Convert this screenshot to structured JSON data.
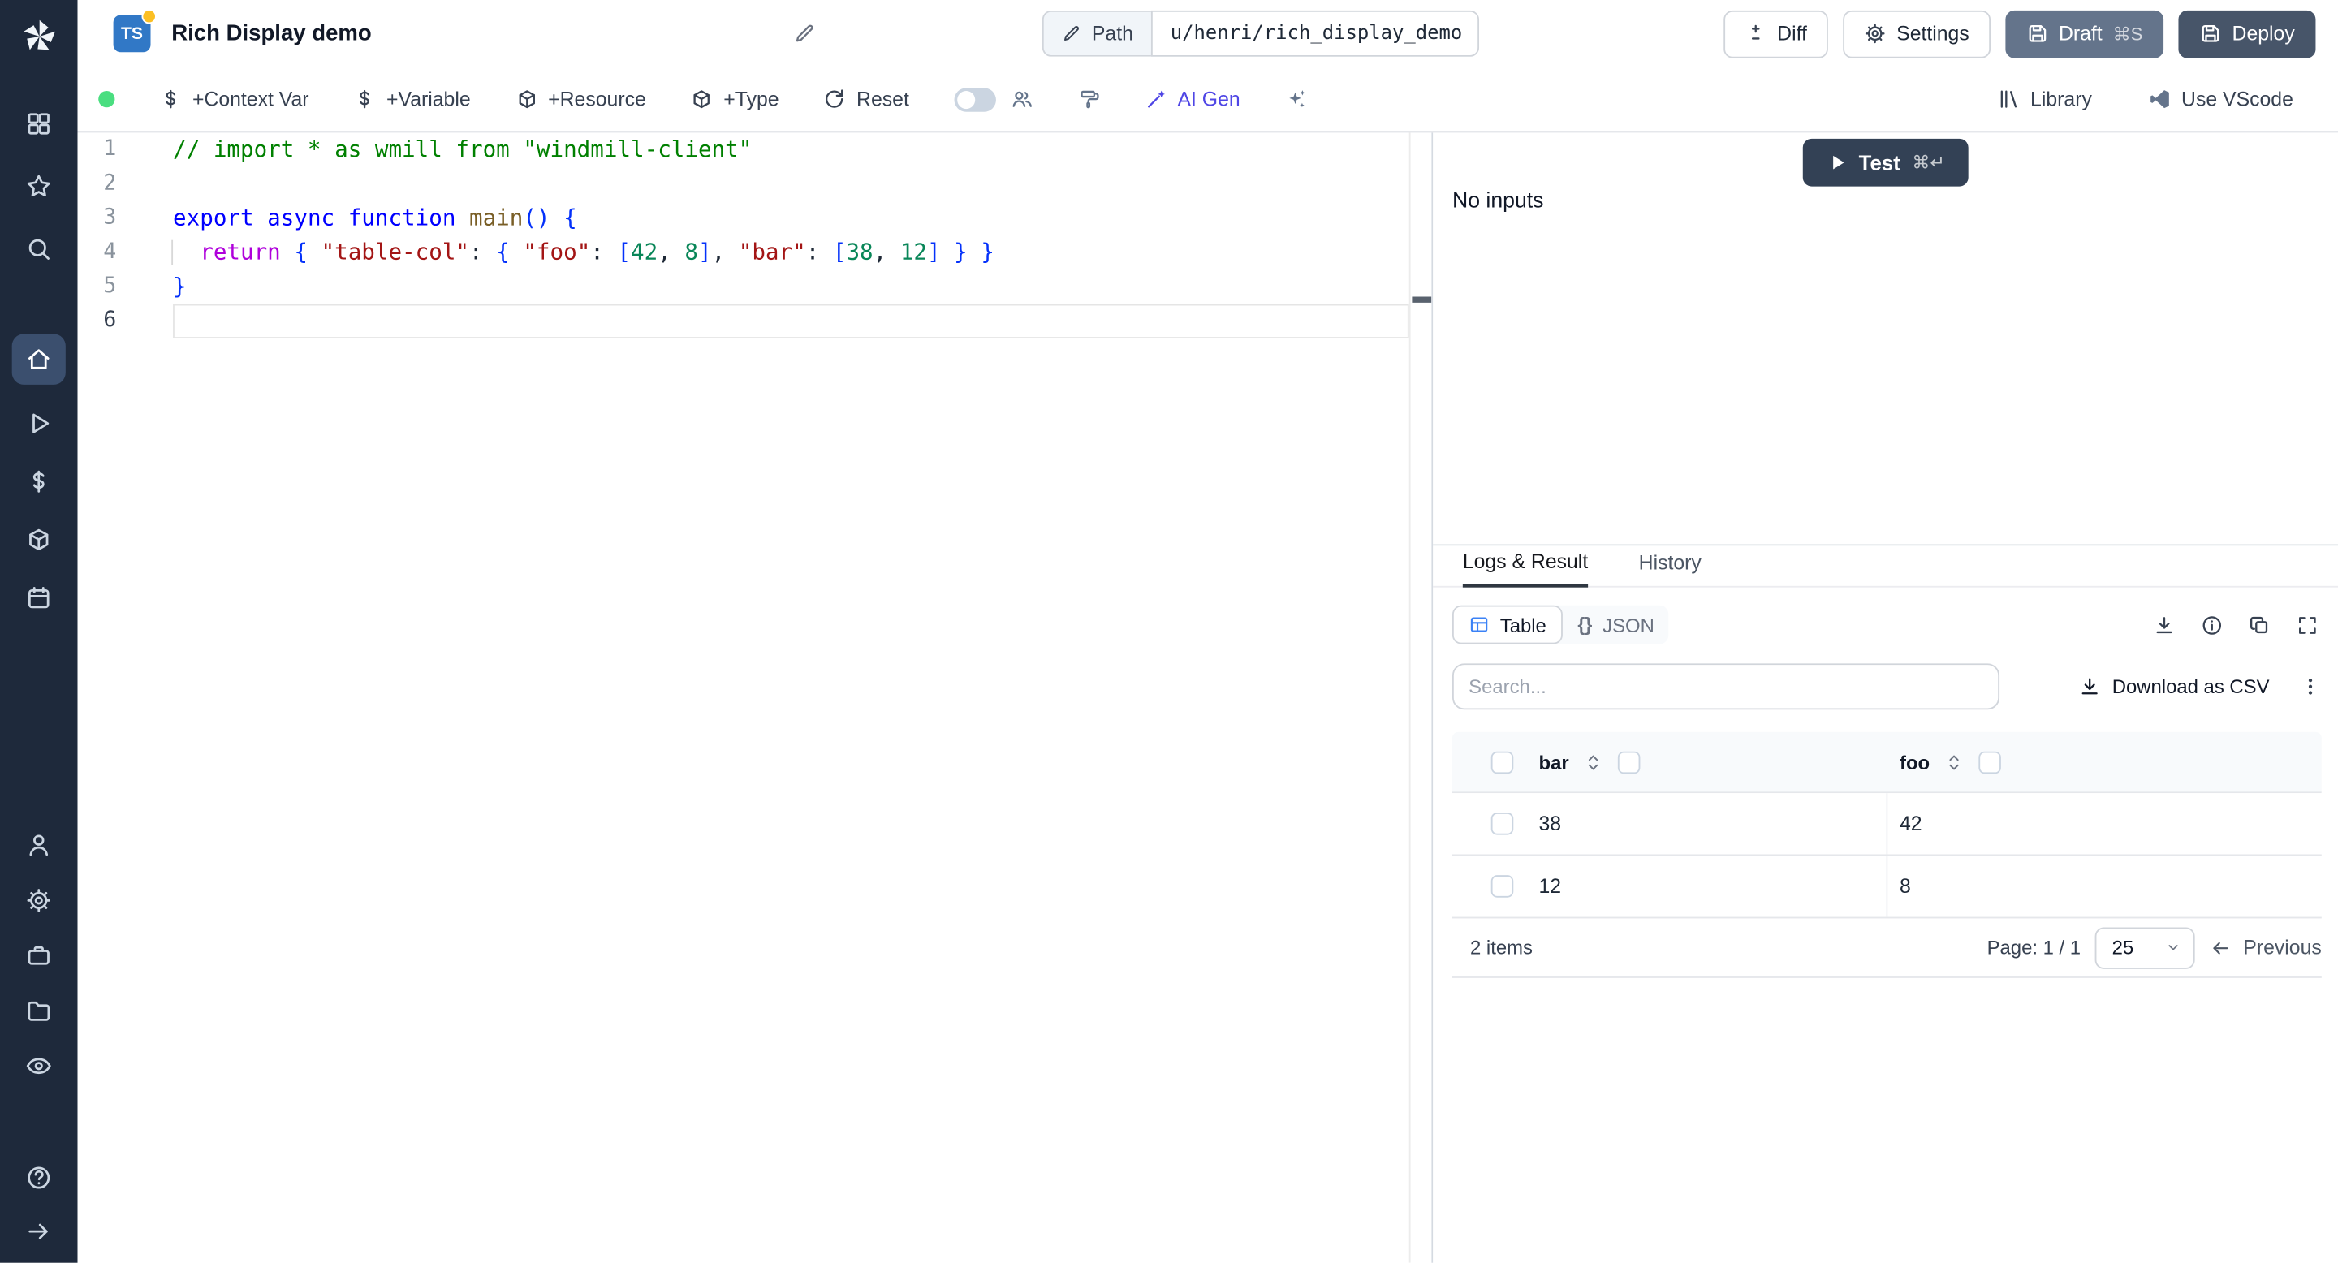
{
  "colors": {
    "sidebar_bg": "#1e293b",
    "ts_badge": "#3178c6",
    "status_green": "#4ade80",
    "accent_ai": "#4f46e5",
    "draft_bg": "#64748b",
    "deploy_bg": "#475569",
    "test_bg": "#334155"
  },
  "icon_names": [
    "windmill-logo",
    "grid-icon",
    "star-icon",
    "search-icon",
    "home-icon",
    "play-icon",
    "dollar-icon",
    "cube-icon",
    "calendar-icon",
    "user-icon",
    "gear-icon",
    "briefcase-icon",
    "folder-icon",
    "eye-icon",
    "help-icon",
    "arrow-right-icon",
    "pencil-icon",
    "plus-minus-icon",
    "save-icon",
    "reset-icon",
    "users-icon",
    "format-roller-icon",
    "magic-wand-icon",
    "sparkles-icon",
    "library-icon",
    "vscode-icon",
    "play-filled-icon",
    "download-icon",
    "info-icon",
    "copy-icon",
    "expand-icon",
    "table-view-icon",
    "braces-icon",
    "kebab-icon",
    "sort-icon",
    "chevron-down-icon",
    "arrow-left-icon"
  ],
  "header": {
    "badge": "TS",
    "title": "Rich Display demo",
    "path_label": "Path",
    "path_value": "u/henri/rich_display_demo",
    "diff_label": "Diff",
    "settings_label": "Settings",
    "draft_label": "Draft",
    "draft_shortcut": "⌘S",
    "deploy_label": "Deploy"
  },
  "toolbar": {
    "add_context_var": "+Context Var",
    "add_variable": "+Variable",
    "add_resource": "+Resource",
    "add_type": "+Type",
    "reset": "Reset",
    "ai_gen": "AI Gen",
    "library": "Library",
    "use_vscode": "Use VScode"
  },
  "editor": {
    "lines": [
      {
        "num": "1",
        "tokens": [
          [
            "cmt",
            "// import * as wmill from \"windmill-client\""
          ]
        ]
      },
      {
        "num": "2",
        "tokens": []
      },
      {
        "num": "3",
        "tokens": [
          [
            "kw",
            "export"
          ],
          [
            "pl",
            " "
          ],
          [
            "kw",
            "async"
          ],
          [
            "pl",
            " "
          ],
          [
            "kw",
            "function"
          ],
          [
            "pl",
            " "
          ],
          [
            "fn",
            "main"
          ],
          [
            "brk",
            "()"
          ],
          [
            "pl",
            " "
          ],
          [
            "brk",
            "{"
          ]
        ]
      },
      {
        "num": "4",
        "guide": true,
        "tokens": [
          [
            "pl",
            "  "
          ],
          [
            "ctl",
            "return"
          ],
          [
            "pl",
            " "
          ],
          [
            "brk",
            "{"
          ],
          [
            "pl",
            " "
          ],
          [
            "str",
            "\"table-col\""
          ],
          [
            "pl",
            ": "
          ],
          [
            "brk",
            "{"
          ],
          [
            "pl",
            " "
          ],
          [
            "str",
            "\"foo\""
          ],
          [
            "pl",
            ": "
          ],
          [
            "brk",
            "["
          ],
          [
            "num",
            "42"
          ],
          [
            "pl",
            ", "
          ],
          [
            "num",
            "8"
          ],
          [
            "brk",
            "]"
          ],
          [
            "pl",
            ", "
          ],
          [
            "str",
            "\"bar\""
          ],
          [
            "pl",
            ": "
          ],
          [
            "brk",
            "["
          ],
          [
            "num",
            "38"
          ],
          [
            "pl",
            ", "
          ],
          [
            "num",
            "12"
          ],
          [
            "brk",
            "]"
          ],
          [
            "pl",
            " "
          ],
          [
            "brk",
            "}"
          ],
          [
            "pl",
            " "
          ],
          [
            "brk",
            "}"
          ]
        ]
      },
      {
        "num": "5",
        "tokens": [
          [
            "brk",
            "}"
          ]
        ]
      },
      {
        "num": "6",
        "current": true,
        "tokens": []
      }
    ]
  },
  "run_panel": {
    "test_label": "Test",
    "test_shortcut": "⌘↵",
    "no_inputs": "No inputs"
  },
  "result_panel": {
    "tab_logs": "Logs & Result",
    "tab_history": "History",
    "view_table": "Table",
    "view_json_braces": "{}",
    "view_json": "JSON",
    "search_placeholder": "Search...",
    "download_csv": "Download as CSV",
    "table": {
      "columns": [
        "bar",
        "foo"
      ],
      "rows": [
        [
          "38",
          "42"
        ],
        [
          "12",
          "8"
        ]
      ]
    },
    "items_count": "2 items",
    "page_label": "Page: 1 / 1",
    "page_size": "25",
    "previous_label": "Previous"
  }
}
